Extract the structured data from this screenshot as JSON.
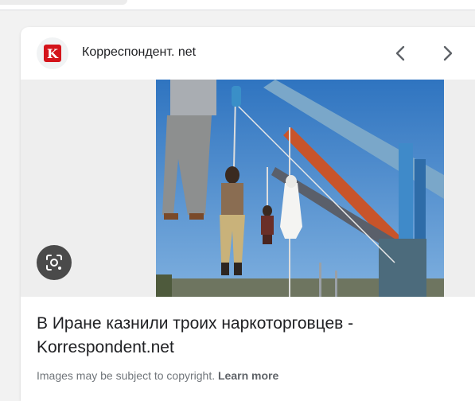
{
  "source": {
    "name": "Корреспондент. net",
    "logo_letter": "K",
    "logo_color": "#d4141b"
  },
  "navigation": {
    "prev_icon": "chevron-left-icon",
    "next_icon": "chevron-right-icon"
  },
  "image": {
    "lens_icon": "google-lens-icon"
  },
  "result": {
    "title": "В Иране казнили троих наркоторговцев - Korrespondent.net"
  },
  "footer": {
    "copyright_text": "Images may be subject to copyright.",
    "learn_more": "Learn more"
  }
}
